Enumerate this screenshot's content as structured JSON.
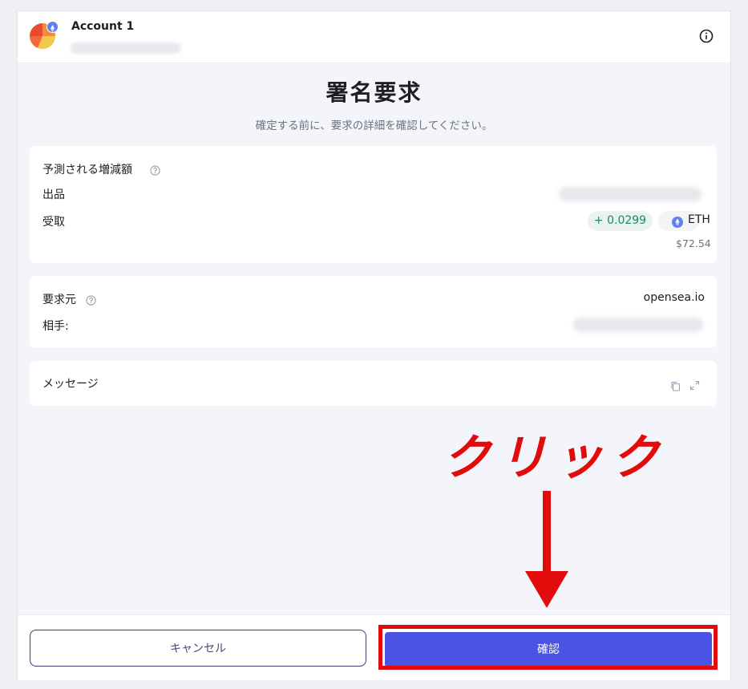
{
  "header": {
    "account_name": "Account 1"
  },
  "page": {
    "title": "署名要求",
    "subtitle": "確定する前に、要求の詳細を確認してください。"
  },
  "balance_card": {
    "heading": "予測される増減額",
    "list_label": "出品",
    "receive_label": "受取",
    "receive_amount": "+ 0.0299",
    "receive_token": "ETH",
    "receive_fiat": "$72.54"
  },
  "request_card": {
    "origin_label": "要求元",
    "origin_value": "opensea.io",
    "counterparty_label": "相手:"
  },
  "message_card": {
    "label": "メッセージ"
  },
  "footer": {
    "cancel_label": "キャンセル",
    "confirm_label": "確認"
  },
  "annotation": {
    "text": "クリック",
    "color": "#e20b0b"
  },
  "colors": {
    "accent": "#4a53e4",
    "positive": "#1c8a5a",
    "eth": "#627eea"
  },
  "icons": [
    "account-avatar-icon",
    "ethereum-icon",
    "info-icon",
    "help-icon",
    "copy-icon",
    "expand-icon",
    "down-arrow"
  ]
}
